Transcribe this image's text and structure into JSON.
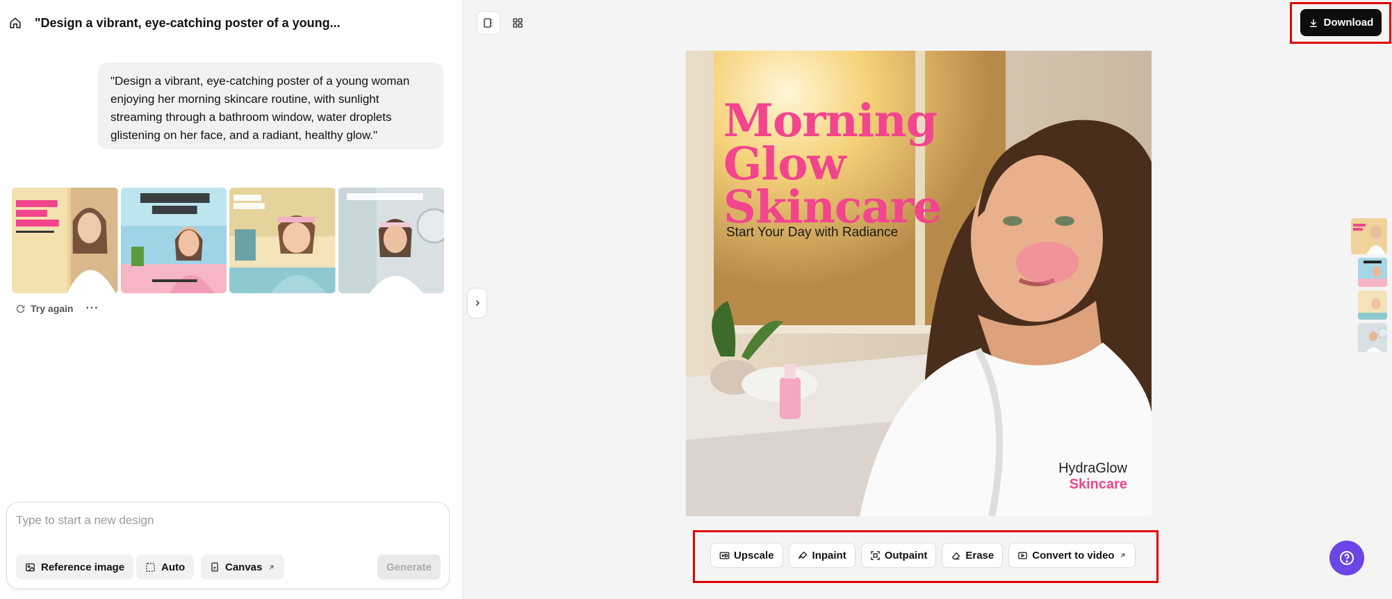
{
  "header": {
    "title": "\"Design a vibrant, eye-catching poster of a young..."
  },
  "prompt": {
    "text": "\"Design a vibrant, eye-catching poster of a young woman enjoying her morning skincare routine, with sunlight streaming through a bathroom window, water droplets glistening on her face, and a radiant, healthy glow.\""
  },
  "results": {
    "thumbnails": [
      {
        "name": "result-1"
      },
      {
        "name": "result-2"
      },
      {
        "name": "result-3"
      },
      {
        "name": "result-4"
      }
    ],
    "try_again_label": "Try again",
    "more_label": "···"
  },
  "composer": {
    "placeholder": "Type to start a new design",
    "reference_label": "Reference image",
    "auto_label": "Auto",
    "canvas_label": "Canvas",
    "generate_label": "Generate"
  },
  "toolbar": {
    "download_label": "Download"
  },
  "poster": {
    "title_line1": "Morning",
    "title_line2": "Glow",
    "title_line3": "Skincare",
    "tagline": "Start Your Day with Radiance",
    "brand_line1": "HydraGlow",
    "brand_line2": "Skincare"
  },
  "tools": {
    "upscale": "Upscale",
    "inpaint": "Inpaint",
    "outpaint": "Outpaint",
    "erase": "Erase",
    "convert": "Convert to video"
  },
  "colors": {
    "accent_pink": "#f2458d",
    "help_purple": "#6b45e6",
    "highlight_red": "#e00000"
  }
}
